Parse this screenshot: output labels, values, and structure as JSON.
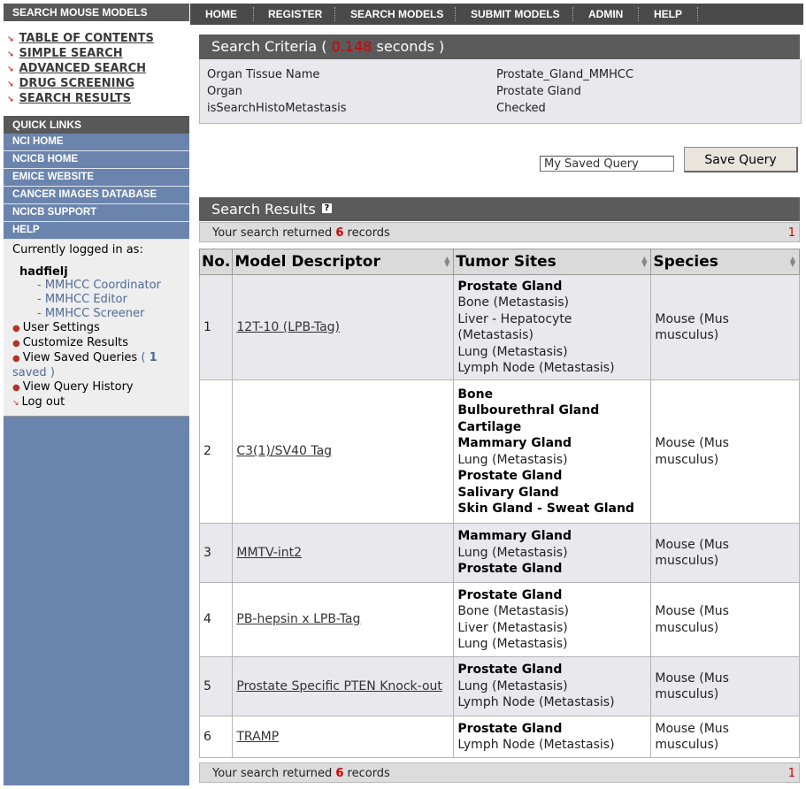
{
  "sidebar": {
    "header": "SEARCH MOUSE MODELS",
    "toc": [
      "TABLE OF CONTENTS",
      "SIMPLE SEARCH",
      "ADVANCED SEARCH",
      "DRUG SCREENING",
      "SEARCH RESULTS"
    ],
    "quick_links_header": "QUICK LINKS",
    "quick_links": [
      "NCI HOME",
      "NCICB HOME",
      "EMICE WEBSITE",
      "CANCER IMAGES DATABASE",
      "NCICB SUPPORT",
      "HELP"
    ],
    "login": {
      "label": "Currently logged in as:",
      "user": "hadfielj",
      "roles": [
        "- MMHCC Coordinator",
        "- MMHCC Editor",
        "- MMHCC Screener"
      ],
      "links": {
        "user_settings": "User Settings",
        "customize": "Customize Results",
        "view_saved": "View Saved Queries",
        "saved_count": "1",
        "saved_suffix": "saved )",
        "history": "View Query History",
        "logout": "Log out"
      }
    }
  },
  "nav": [
    "HOME",
    "REGISTER",
    "SEARCH MODELS",
    "SUBMIT MODELS",
    "ADMIN",
    "HELP"
  ],
  "criteria": {
    "title_prefix": "Search Criteria (",
    "seconds_value": "0.148",
    "title_suffix": "seconds )",
    "rows": [
      {
        "name": "Organ Tissue Name",
        "value": "Prostate_Gland_MMHCC"
      },
      {
        "name": "Organ",
        "value": "Prostate Gland"
      },
      {
        "name": "isSearchHistoMetastasis",
        "value": "Checked"
      }
    ]
  },
  "save_query": {
    "input_value": "My Saved Query",
    "button": "Save Query"
  },
  "results": {
    "title": "Search Results",
    "help_icon": "?",
    "summary_prefix": "Your search returned",
    "summary_count": "6",
    "summary_suffix": "records",
    "page": "1",
    "columns": [
      "No.",
      "Model Descriptor",
      "Tumor Sites",
      "Species"
    ],
    "rows": [
      {
        "no": "1",
        "model": "12T-10 (LPB-Tag)",
        "species": "Mouse (Mus musculus)",
        "sites": [
          {
            "t": "Prostate Gland",
            "b": true
          },
          {
            "t": "Bone (Metastasis)",
            "b": false
          },
          {
            "t": "Liver - Hepatocyte (Metastasis)",
            "b": false
          },
          {
            "t": "Lung (Metastasis)",
            "b": false
          },
          {
            "t": "Lymph Node (Metastasis)",
            "b": false
          }
        ]
      },
      {
        "no": "2",
        "model": "C3(1)/SV40 Tag",
        "species": "Mouse (Mus musculus)",
        "sites": [
          {
            "t": "Bone",
            "b": true
          },
          {
            "t": "Bulbourethral Gland",
            "b": true
          },
          {
            "t": "Cartilage",
            "b": true
          },
          {
            "t": "Mammary Gland",
            "b": true
          },
          {
            "t": "Lung (Metastasis)",
            "b": false
          },
          {
            "t": "Prostate Gland",
            "b": true
          },
          {
            "t": "Salivary Gland",
            "b": true
          },
          {
            "t": "Skin Gland - Sweat Gland",
            "b": true
          }
        ]
      },
      {
        "no": "3",
        "model": "MMTV-int2",
        "species": "Mouse (Mus musculus)",
        "sites": [
          {
            "t": "Mammary Gland",
            "b": true
          },
          {
            "t": "Lung (Metastasis)",
            "b": false
          },
          {
            "t": "Prostate Gland",
            "b": true
          }
        ]
      },
      {
        "no": "4",
        "model": "PB-hepsin x LPB-Tag",
        "species": "Mouse (Mus musculus)",
        "sites": [
          {
            "t": "Prostate Gland",
            "b": true
          },
          {
            "t": "Bone (Metastasis)",
            "b": false
          },
          {
            "t": "Liver (Metastasis)",
            "b": false
          },
          {
            "t": "Lung (Metastasis)",
            "b": false
          }
        ]
      },
      {
        "no": "5",
        "model": "Prostate Specific PTEN Knock-out",
        "species": "Mouse (Mus musculus)",
        "sites": [
          {
            "t": "Prostate Gland",
            "b": true
          },
          {
            "t": "Lung (Metastasis)",
            "b": false
          },
          {
            "t": "Lymph Node (Metastasis)",
            "b": false
          }
        ]
      },
      {
        "no": "6",
        "model": "TRAMP",
        "species": "Mouse (Mus musculus)",
        "sites": [
          {
            "t": "Prostate Gland",
            "b": true
          },
          {
            "t": "Lymph Node (Metastasis)",
            "b": false
          }
        ]
      }
    ]
  },
  "colors": {
    "accent_red": "#d40000",
    "sidebar_blue": "#6b84ad",
    "header_gray": "#5b5b5b"
  }
}
